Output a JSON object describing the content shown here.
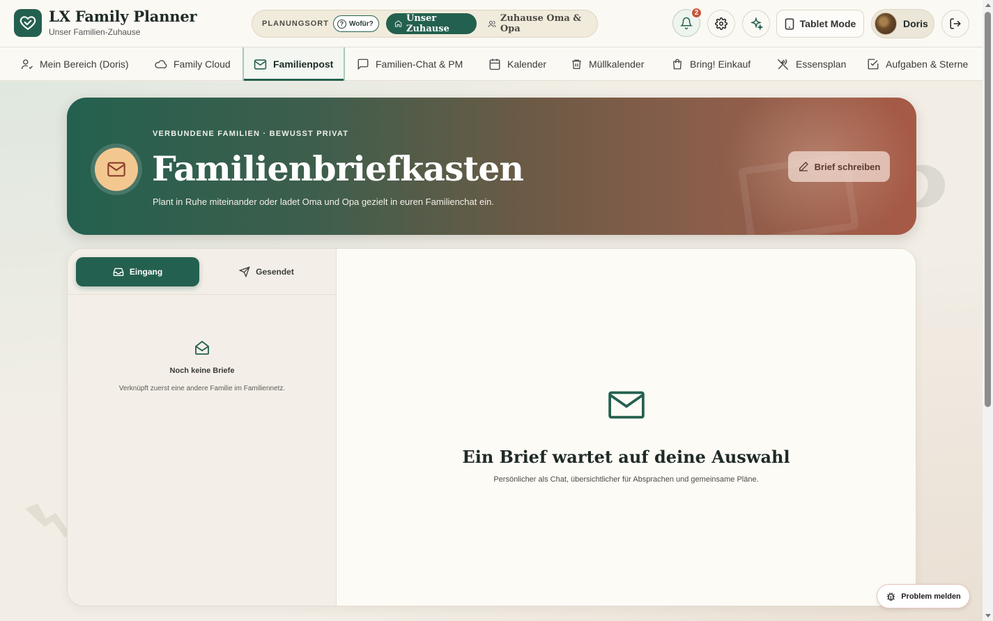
{
  "app": {
    "title": "LX Family Planner",
    "subtitle": "Unser Familien-Zuhause"
  },
  "location": {
    "label": "PLANUNGSORT",
    "help": "Wofür?",
    "options": [
      {
        "label": "Unser Zuhause",
        "active": true
      },
      {
        "label": "Zuhause Oma & Opa",
        "active": false
      }
    ]
  },
  "header": {
    "notifications_count": "2",
    "tablet_mode": "Tablet Mode",
    "user_name": "Doris"
  },
  "nav": {
    "items": [
      {
        "label": "Mein Bereich (Doris)",
        "icon": "user-check-icon"
      },
      {
        "label": "Family Cloud",
        "icon": "cloud-icon"
      },
      {
        "label": "Familienpost",
        "icon": "mail-icon",
        "active": true
      },
      {
        "label": "Familien-Chat & PM",
        "icon": "chat-icon"
      },
      {
        "label": "Kalender",
        "icon": "calendar-icon"
      },
      {
        "label": "Müllkalender",
        "icon": "trash-icon"
      },
      {
        "label": "Bring! Einkauf",
        "icon": "shopping-bag-icon"
      },
      {
        "label": "Essensplan",
        "icon": "utensils-icon"
      },
      {
        "label": "Aufgaben & Sterne",
        "icon": "check-square-icon"
      }
    ]
  },
  "hero": {
    "eyebrow": "VERBUNDENE FAMILIEN · BEWUSST PRIVAT",
    "title": "Familienbriefkasten",
    "subtitle": "Plant in Ruhe miteinander oder ladet Oma und Opa gezielt in euren Familienchat ein.",
    "button": "Brief schreiben"
  },
  "mail": {
    "tabs": [
      {
        "label": "Eingang",
        "active": true
      },
      {
        "label": "Gesendet",
        "active": false
      }
    ],
    "empty_list_title": "Noch keine Briefe",
    "empty_list_text": "Verknüpft zuerst eine andere Familie im Familiennetz.",
    "empty_detail_title": "Ein Brief wartet auf deine Auswahl",
    "empty_detail_text": "Persönlicher als Chat, übersichtlicher für Absprachen und gemeinsame Pläne."
  },
  "footer": {
    "report_button": "Problem melden"
  },
  "colors": {
    "primary": "#24604f",
    "accent": "#c8553d",
    "hero_icon_bg": "#f3c890"
  }
}
